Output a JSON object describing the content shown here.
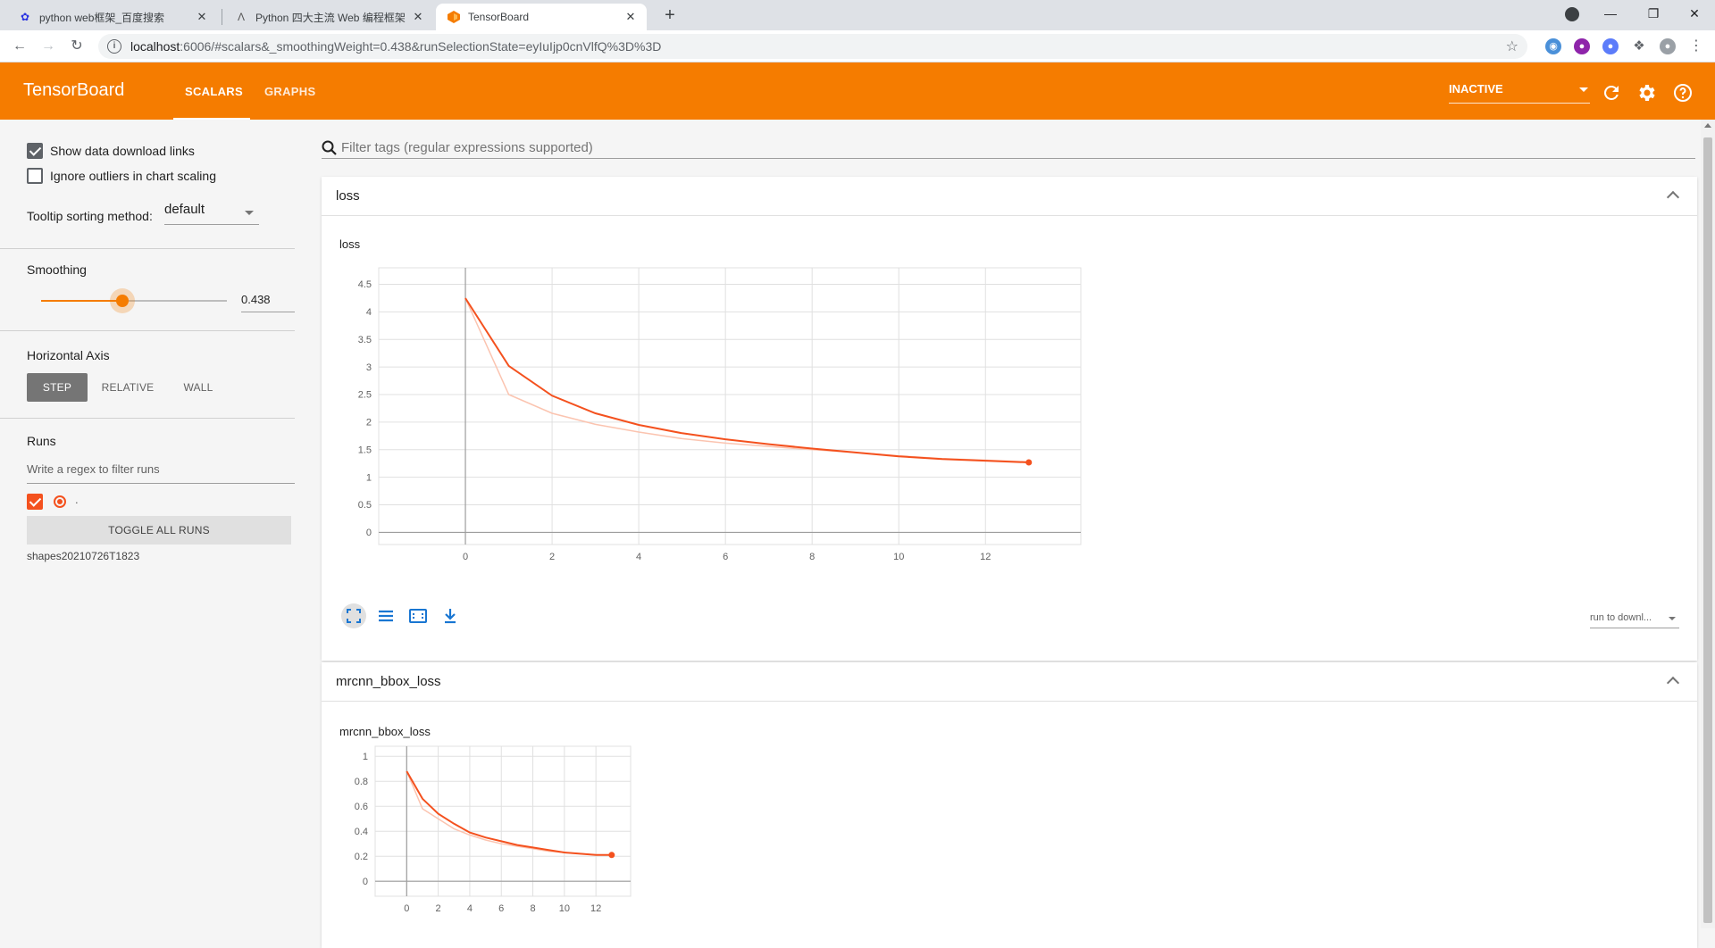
{
  "browser": {
    "tabs": [
      {
        "title": "python web框架_百度搜索",
        "active": false
      },
      {
        "title": "Python 四大主流 Web 编程框架",
        "active": false
      },
      {
        "title": "TensorBoard",
        "active": true
      }
    ],
    "url_host": "localhost",
    "url_path": ":6006/#scalars&_smoothingWeight=0.438&runSelectionState=eyIuIjp0cnVlfQ%3D%3D"
  },
  "header": {
    "brand": "TensorBoard",
    "tabs": [
      {
        "label": "SCALARS"
      },
      {
        "label": "GRAPHS"
      }
    ],
    "status_select": "INACTIVE",
    "accent": "#f57c00"
  },
  "sidebar": {
    "show_download_links": {
      "label": "Show data download links",
      "checked": true
    },
    "ignore_outliers": {
      "label": "Ignore outliers in chart scaling",
      "checked": false
    },
    "tooltip_label": "Tooltip sorting method:",
    "tooltip_value": "default",
    "smoothing_title": "Smoothing",
    "smoothing_value": "0.438",
    "smoothing_fraction": 0.438,
    "haxis_title": "Horizontal Axis",
    "haxis_buttons": [
      {
        "label": "STEP"
      },
      {
        "label": "RELATIVE"
      },
      {
        "label": "WALL"
      }
    ],
    "runs_title": "Runs",
    "runs_placeholder": "Write a regex to filter runs",
    "run_label": ".",
    "toggle_all": "TOGGLE ALL RUNS",
    "run_name": "shapes20210726T1823"
  },
  "main": {
    "filter_placeholder": "Filter tags (regular expressions supported)",
    "download_select": "run to downl..."
  },
  "cards": [
    {
      "header": "loss"
    },
    {
      "header": "mrcnn_bbox_loss"
    }
  ],
  "chart_data": [
    {
      "type": "line",
      "title": "loss",
      "x": [
        0,
        1,
        2,
        3,
        4,
        5,
        6,
        7,
        8,
        9,
        10,
        11,
        12,
        13
      ],
      "series": [
        {
          "values": [
            4.25,
            3.02,
            2.48,
            2.16,
            1.95,
            1.8,
            1.69,
            1.6,
            1.52,
            1.45,
            1.38,
            1.33,
            1.3,
            1.27
          ],
          "color": "#f4511e"
        },
        {
          "values": [
            4.25,
            2.5,
            2.16,
            1.96,
            1.82,
            1.7,
            1.62,
            1.56,
            1.5,
            1.45,
            1.39,
            1.34,
            1.31,
            1.28
          ],
          "color": "#fbc4b0"
        }
      ],
      "xticks": [
        0,
        2,
        4,
        6,
        8,
        10,
        12
      ],
      "yticks": [
        0,
        0.5,
        1,
        1.5,
        2,
        2.5,
        3,
        3.5,
        4,
        4.5
      ],
      "xlim": [
        -2,
        14.2
      ],
      "ylim": [
        -0.22,
        4.8
      ],
      "grid": true
    },
    {
      "type": "line",
      "title": "mrcnn_bbox_loss",
      "x": [
        0,
        1,
        2,
        3,
        4,
        5,
        6,
        7,
        8,
        9,
        10,
        11,
        12,
        13
      ],
      "series": [
        {
          "values": [
            0.88,
            0.66,
            0.54,
            0.46,
            0.39,
            0.35,
            0.32,
            0.29,
            0.27,
            0.25,
            0.23,
            0.22,
            0.21,
            0.21
          ],
          "color": "#f4511e"
        },
        {
          "values": [
            0.88,
            0.58,
            0.5,
            0.42,
            0.37,
            0.33,
            0.3,
            0.28,
            0.26,
            0.24,
            0.23,
            0.22,
            0.21,
            0.21
          ],
          "color": "#fbc4b0"
        }
      ],
      "xticks": [
        0,
        2,
        4,
        6,
        8,
        10,
        12
      ],
      "yticks": [
        0,
        0.2,
        0.4,
        0.6,
        0.8,
        1
      ],
      "xlim": [
        -2,
        14.2
      ],
      "ylim": [
        -0.12,
        1.08
      ],
      "grid": true
    }
  ]
}
